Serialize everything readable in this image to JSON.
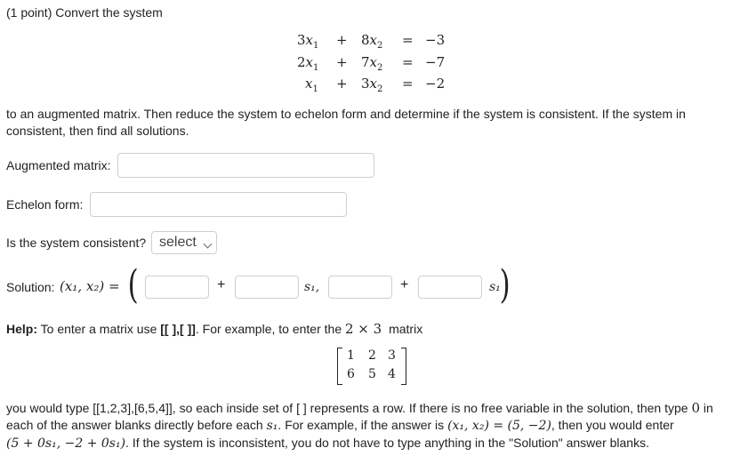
{
  "header": {
    "points_label": "(1 point) Convert the system"
  },
  "system": {
    "rows": [
      {
        "c1": "3",
        "v1": "x",
        "s1": "1",
        "op": "+",
        "c2": "8",
        "v2": "x",
        "s2": "2",
        "eq": "=",
        "rhs": "−3"
      },
      {
        "c1": "2",
        "v1": "x",
        "s1": "1",
        "op": "+",
        "c2": "7",
        "v2": "x",
        "s2": "2",
        "eq": "=",
        "rhs": "−7"
      },
      {
        "c1": "",
        "v1": "x",
        "s1": "1",
        "op": "+",
        "c2": "3",
        "v2": "x",
        "s2": "2",
        "eq": "=",
        "rhs": "−2"
      }
    ]
  },
  "instructions": {
    "line1": "to an augmented matrix. Then reduce the system to echelon form and determine if the system is consistent. If the system in",
    "line2": "consistent, then find all solutions."
  },
  "augmented": {
    "label": "Augmented matrix:",
    "value": ""
  },
  "echelon": {
    "label": "Echelon form:",
    "value": ""
  },
  "consistent": {
    "label": "Is the system consistent?",
    "selected": "select"
  },
  "solution": {
    "label": "Solution:",
    "lhs": "(x₁, x₂) =",
    "plus": "+",
    "s1_comma": "s₁,",
    "s1": "s₁",
    "blanks": [
      "",
      "",
      "",
      ""
    ]
  },
  "help": {
    "bold": "Help:",
    "text_before": " To enter a matrix use ",
    "brackets": "[[ ],[ ]]",
    "text_after": ". For example, to enter the ",
    "dim": "2 × 3",
    "text_end": " matrix",
    "matrix": [
      [
        "1",
        "2",
        "3"
      ],
      [
        "6",
        "5",
        "4"
      ]
    ],
    "p1": "you would type [[1,2,3],[6,5,4]], so each inside set of [ ] represents a row. If there is no free variable in the solution, then type",
    "zero": "0",
    "p1_end": "in",
    "p2": "each of the answer blanks directly before each",
    "p2_s1": "s₁",
    "p2_b": ". For example, if the answer is",
    "p2_ex": "(x₁, x₂) = (5, −2)",
    "p2_c": ", then you would enter",
    "p3_ex": "(5 + 0s₁, −2 + 0s₁)",
    "p3": ". If the system is inconsistent, you do not have to type anything in the \"Solution\" answer blanks."
  }
}
